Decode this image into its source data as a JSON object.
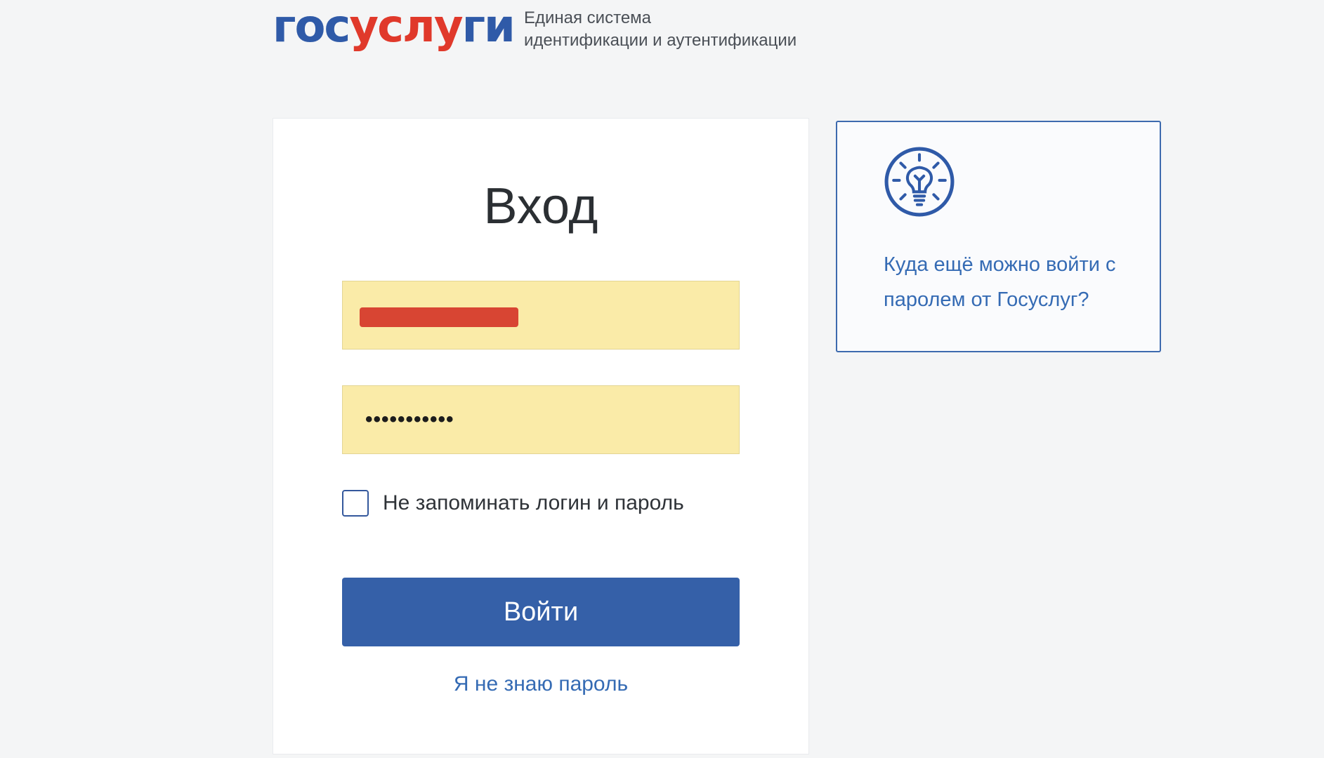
{
  "header": {
    "logo": {
      "part1": "гос",
      "part2": "услу",
      "part3": "ги"
    },
    "tagline_line1": "Единая система",
    "tagline_line2": "идентификации и аутентификации"
  },
  "login_form": {
    "title": "Вход",
    "login_value": "",
    "password_masked": "•••••••••••",
    "remember_label": "Не запоминать логин и пароль",
    "remember_checked": false,
    "submit_label": "Войти",
    "forgot_link": "Я не знаю пароль"
  },
  "info_box": {
    "icon": "lightbulb-icon",
    "text": "Куда ещё можно войти с паролем от Госуслуг?"
  },
  "colors": {
    "brand_blue": "#2f5aa8",
    "brand_red": "#e0392b",
    "button_blue": "#3560a8",
    "link_blue": "#356bb4",
    "autofill_yellow": "#faeba8",
    "redaction_red": "#d84533"
  }
}
